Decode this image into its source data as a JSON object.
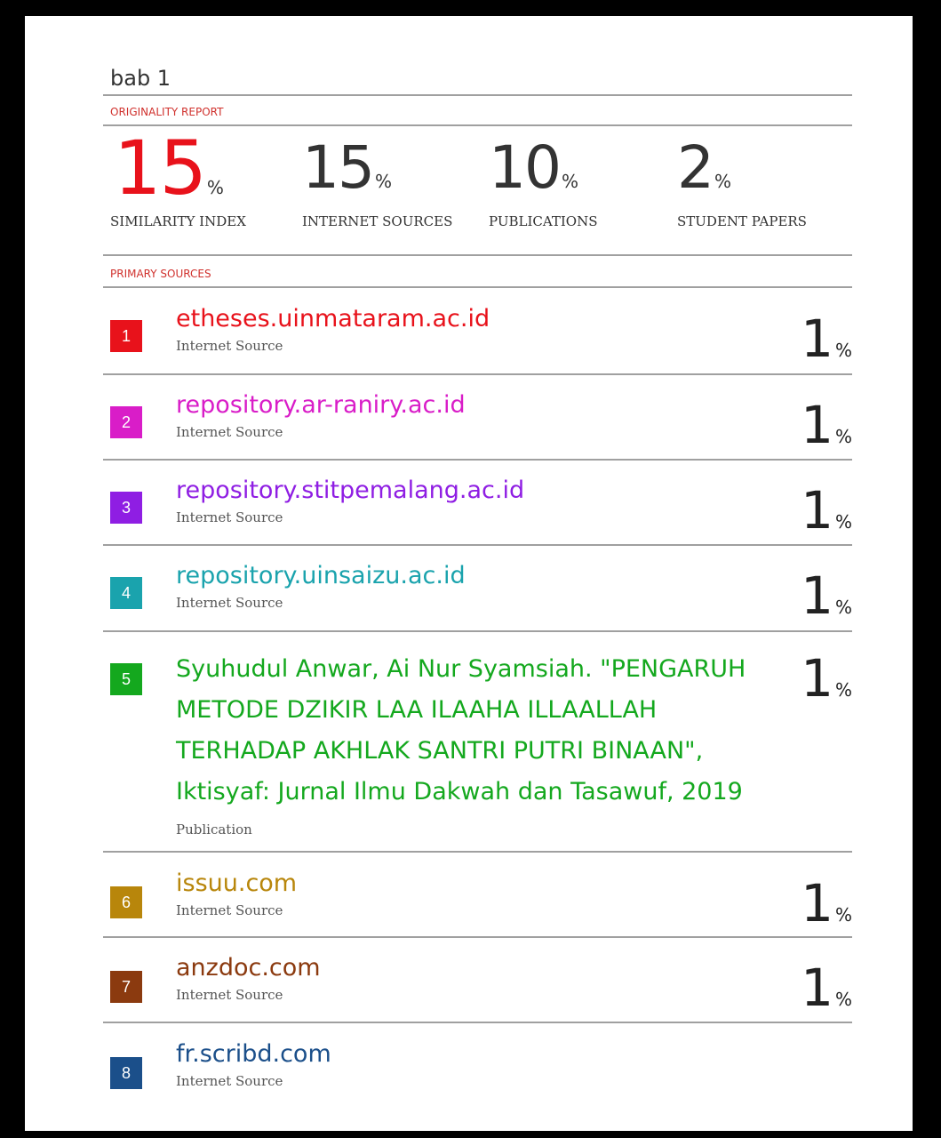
{
  "title": "bab 1",
  "originality_report_label": "ORIGINALITY REPORT",
  "stats": [
    {
      "value": "15",
      "unit": "%",
      "label": "SIMILARITY INDEX"
    },
    {
      "value": "15",
      "unit": "%",
      "label": "INTERNET SOURCES"
    },
    {
      "value": "10",
      "unit": "%",
      "label": "PUBLICATIONS"
    },
    {
      "value": "2",
      "unit": "%",
      "label": "STUDENT PAPERS"
    }
  ],
  "primary_sources_label": "PRIMARY SOURCES",
  "sources": [
    {
      "number": "1",
      "name": "etheses.uinmataram.ac.id",
      "type": "Internet Source",
      "percent": "1",
      "unit": "%",
      "color": "#e8121b"
    },
    {
      "number": "2",
      "name": "repository.ar-raniry.ac.id",
      "type": "Internet Source",
      "percent": "1",
      "unit": "%",
      "color": "#d91dc8"
    },
    {
      "number": "3",
      "name": "repository.stitpemalang.ac.id",
      "type": "Internet Source",
      "percent": "1",
      "unit": "%",
      "color": "#8f1ee3"
    },
    {
      "number": "4",
      "name": "repository.uinsaizu.ac.id",
      "type": "Internet Source",
      "percent": "1",
      "unit": "%",
      "color": "#1aa3ad"
    },
    {
      "number": "5",
      "name": "Syuhudul Anwar, Ai Nur Syamsiah. \"PENGARUH METODE DZIKIR LAA ILAAHA ILLAALLAH TERHADAP AKHLAK SANTRI PUTRI BINAAN\", Iktisyaf: Jurnal Ilmu Dakwah dan Tasawuf, 2019",
      "type": "Publication",
      "percent": "1",
      "unit": "%",
      "color": "#14a81e"
    },
    {
      "number": "6",
      "name": "issuu.com",
      "type": "Internet Source",
      "percent": "1",
      "unit": "%",
      "color": "#b8860b"
    },
    {
      "number": "7",
      "name": "anzdoc.com",
      "type": "Internet Source",
      "percent": "1",
      "unit": "%",
      "color": "#8b3a0f"
    },
    {
      "number": "8",
      "name": "fr.scribd.com",
      "type": "Internet Source",
      "color": "#1b4f8a"
    }
  ]
}
